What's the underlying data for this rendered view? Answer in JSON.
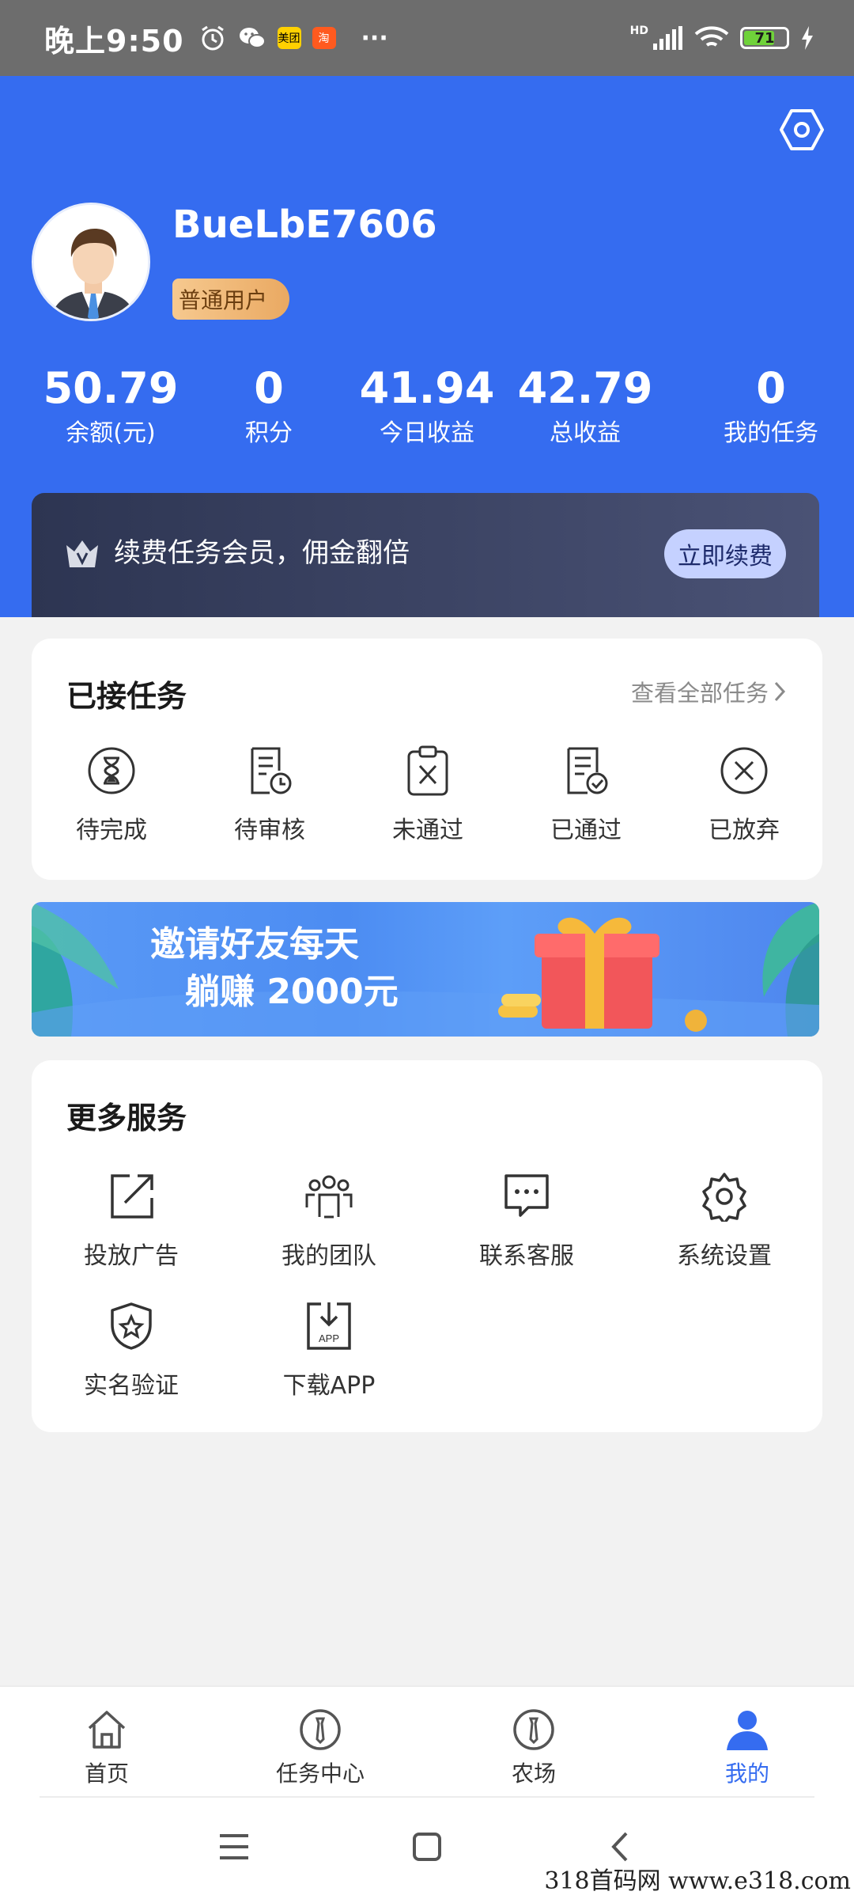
{
  "status_bar": {
    "time": "晚上9:50",
    "app_icons": [
      "alarm-icon",
      "wechat-icon",
      "meituan-icon",
      "taobao-icon"
    ],
    "meituan_label": "美团",
    "taobao_label": "淘",
    "more": "···",
    "network": "HD",
    "battery": "71",
    "battery_level": 0.71
  },
  "header": {
    "username": "BueLbE7606",
    "user_level": "普通用户",
    "stats": [
      {
        "value": "50.79",
        "label": "余额(元)"
      },
      {
        "value": "0",
        "label": "积分"
      },
      {
        "value": "41.94",
        "label": "今日收益"
      },
      {
        "value": "42.79",
        "label": "总收益"
      },
      {
        "value": "0",
        "label": "我的任务"
      }
    ],
    "vip_text": "续费任务会员，佣金翻倍",
    "vip_button": "立即续费"
  },
  "tasks_card": {
    "title": "已接任务",
    "link": "查看全部任务",
    "items": [
      {
        "label": "待完成",
        "icon": "hourglass-icon"
      },
      {
        "label": "待审核",
        "icon": "document-clock-icon"
      },
      {
        "label": "未通过",
        "icon": "clipboard-x-icon"
      },
      {
        "label": "已通过",
        "icon": "document-check-icon"
      },
      {
        "label": "已放弃",
        "icon": "circle-x-icon"
      }
    ]
  },
  "banner": {
    "line1": "邀请好友每天",
    "line2": "躺赚 2000元"
  },
  "services_card": {
    "title": "更多服务",
    "items": [
      {
        "label": "投放广告",
        "icon": "external-link-icon"
      },
      {
        "label": "我的团队",
        "icon": "team-icon"
      },
      {
        "label": "联系客服",
        "icon": "chat-icon"
      },
      {
        "label": "系统设置",
        "icon": "gear-icon"
      },
      {
        "label": "实名验证",
        "icon": "shield-star-icon"
      },
      {
        "label": "下载APP",
        "icon": "download-app-icon"
      }
    ],
    "app_icon_text": "APP"
  },
  "bottom_nav": {
    "items": [
      {
        "label": "首页",
        "icon": "home-icon",
        "active": false
      },
      {
        "label": "任务中心",
        "icon": "task-center-icon",
        "active": false
      },
      {
        "label": "农场",
        "icon": "farm-icon",
        "active": false
      },
      {
        "label": "我的",
        "icon": "user-icon",
        "active": true
      }
    ]
  },
  "watermark": "318首码网  www.e318.com",
  "colors": {
    "primary": "#356cf0",
    "vip_bg": "#2d3552",
    "badge": "#eaa962",
    "status_bar": "#6d6d6d"
  }
}
